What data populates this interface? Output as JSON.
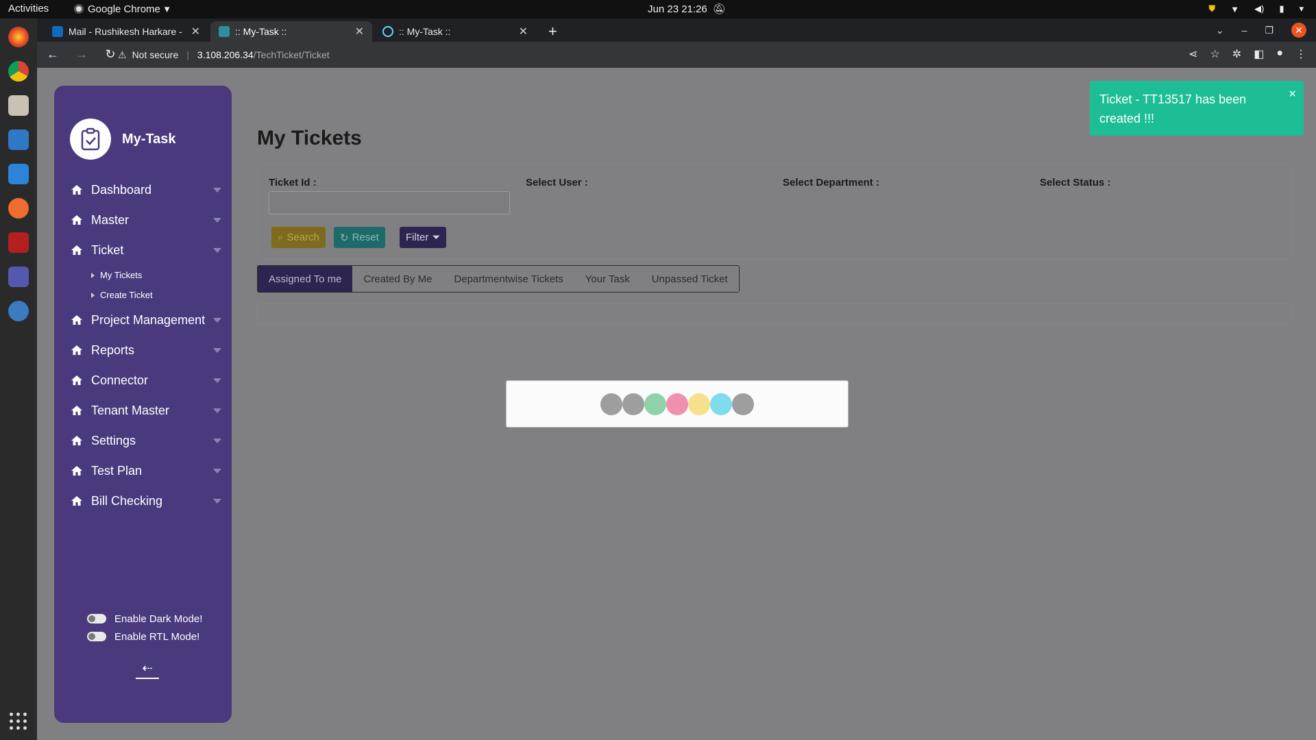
{
  "os": {
    "activities": "Activities",
    "app_name": "Google Chrome",
    "clock": "Jun 23  21:26"
  },
  "browser": {
    "tabs": [
      {
        "label": "Mail - Rushikesh Harkare -"
      },
      {
        "label": ":: My-Task ::"
      },
      {
        "label": ":: My-Task ::"
      }
    ],
    "security_label": "Not secure",
    "url_host": "3.108.206.34",
    "url_path": "/TechTicket/Ticket"
  },
  "sidebar": {
    "brand": "My-Task",
    "items": [
      {
        "label": "Dashboard"
      },
      {
        "label": "Master"
      },
      {
        "label": "Ticket"
      },
      {
        "label": "Project Management"
      },
      {
        "label": "Reports"
      },
      {
        "label": "Connector"
      },
      {
        "label": "Tenant Master"
      },
      {
        "label": "Settings"
      },
      {
        "label": "Test Plan"
      },
      {
        "label": "Bill Checking"
      }
    ],
    "ticket_sub": [
      {
        "label": "My Tickets"
      },
      {
        "label": "Create Ticket"
      }
    ],
    "dark_mode": "Enable Dark Mode!",
    "rtl_mode": "Enable RTL Mode!",
    "collapse_icon": "arrow-left-icon"
  },
  "main": {
    "title": "My Tickets",
    "filters": {
      "ticket_id": "Ticket Id :",
      "user": "Select User :",
      "department": "Select Department :",
      "status": "Select Status :",
      "ticket_id_value": ""
    },
    "buttons": {
      "search": "Search",
      "reset": "Reset",
      "filter": "Filter"
    },
    "tabs": [
      {
        "label": "Assigned To me"
      },
      {
        "label": "Created By Me"
      },
      {
        "label": "Departmentwise Tickets"
      },
      {
        "label": "Your Task"
      },
      {
        "label": "Unpassed Ticket"
      }
    ]
  },
  "loader": {
    "dot_colors": [
      "#9e9e9e",
      "#9e9e9e",
      "#8fd1a8",
      "#f08fae",
      "#f7e08a",
      "#7fdcec",
      "#9e9e9e"
    ]
  },
  "toast": {
    "message": "Ticket - TT13517 has been created !!!",
    "color": "#1dbd95"
  },
  "colors": {
    "sidebar": "#4a3a7d",
    "overlay": "#808082"
  }
}
